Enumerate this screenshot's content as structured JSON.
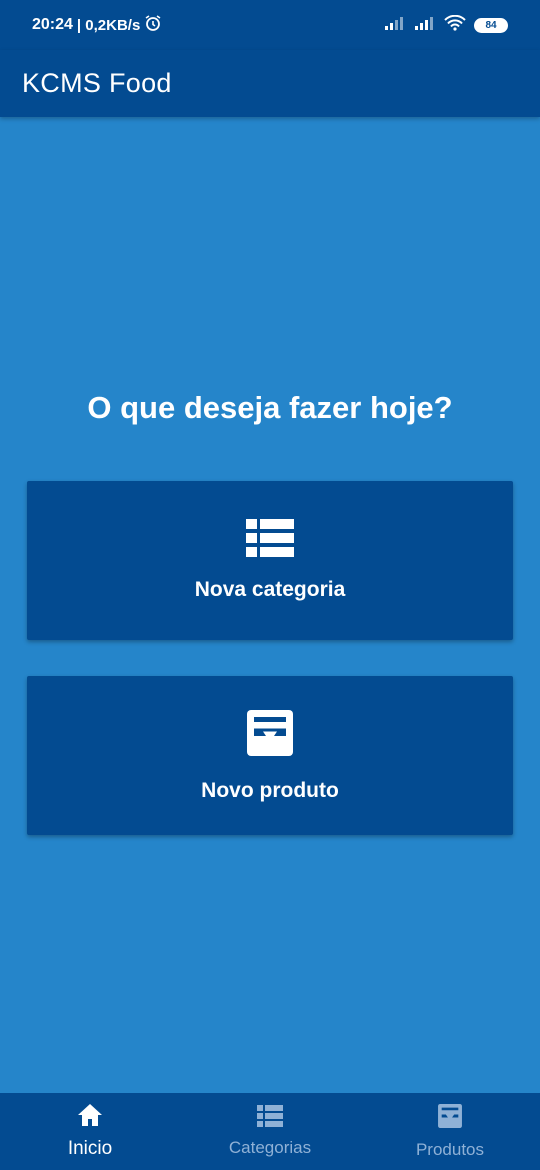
{
  "status_bar": {
    "time": "20:24",
    "net_speed": "| 0,2KB/s",
    "battery": "84",
    "icons": [
      "alarm-icon",
      "signal-icon",
      "signal-icon",
      "wifi-icon",
      "battery-icon"
    ]
  },
  "app_bar": {
    "title": "KCMS Food"
  },
  "main": {
    "heading": "O que deseja fazer hoje?",
    "cards": [
      {
        "label": "Nova categoria",
        "icon": "list-icon"
      },
      {
        "label": "Novo produto",
        "icon": "inbox-icon"
      }
    ]
  },
  "bottom_nav": {
    "items": [
      {
        "label": "Inicio",
        "icon": "home-icon",
        "active": true
      },
      {
        "label": "Categorias",
        "icon": "list-icon",
        "active": false
      },
      {
        "label": "Produtos",
        "icon": "inbox-icon",
        "active": false
      }
    ]
  },
  "colors": {
    "primary_dark": "#034B91",
    "background": "#2585CA",
    "inactive_text": "#8FB1D6"
  }
}
